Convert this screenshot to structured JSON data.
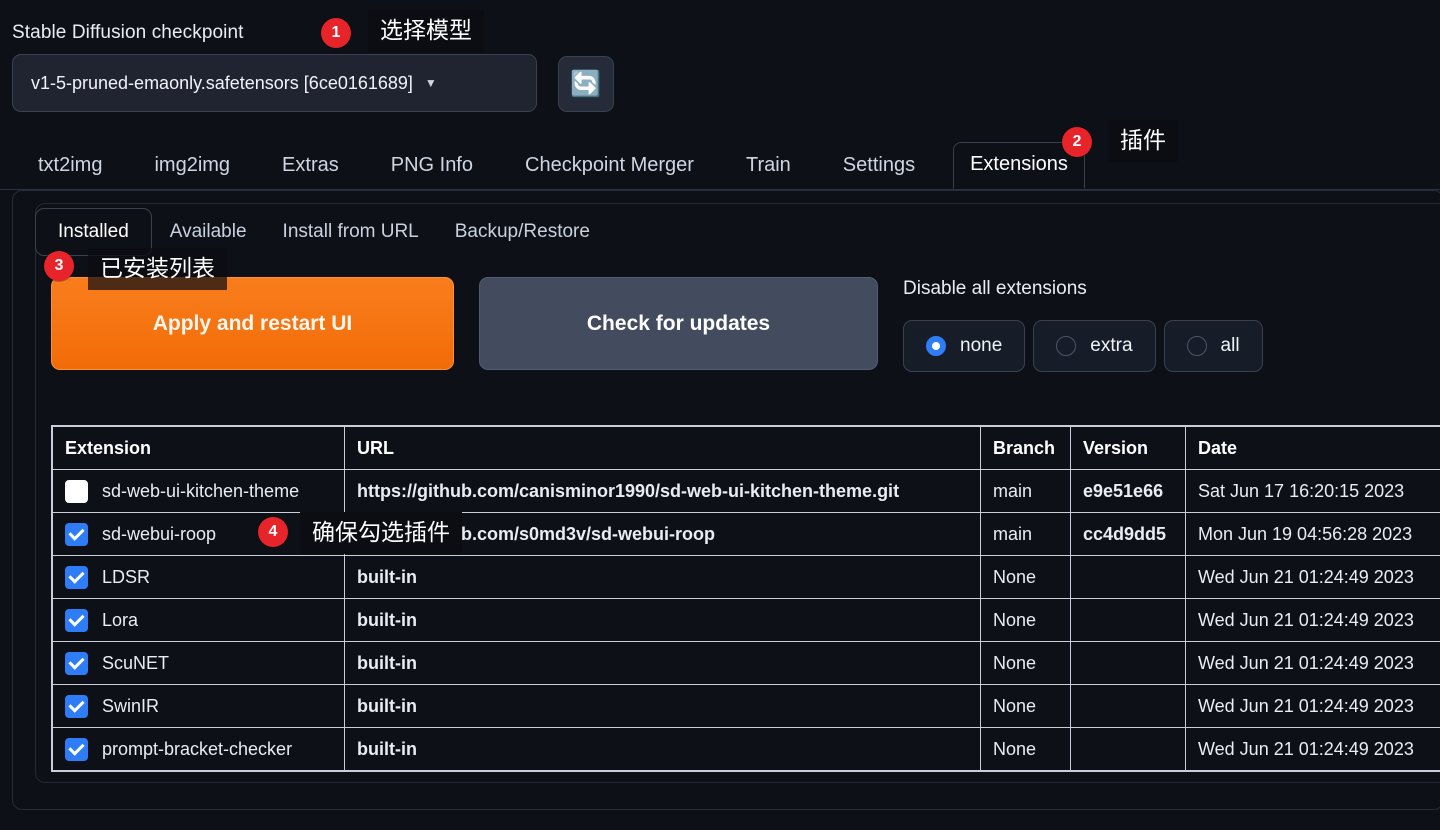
{
  "checkpoint": {
    "label": "Stable Diffusion checkpoint",
    "value": "v1-5-pruned-emaonly.safetensors [6ce0161689]",
    "caret": "▼",
    "refresh_icon": "🔄"
  },
  "top_tabs": [
    {
      "label": "txt2img",
      "active": false
    },
    {
      "label": "img2img",
      "active": false
    },
    {
      "label": "Extras",
      "active": false
    },
    {
      "label": "PNG Info",
      "active": false
    },
    {
      "label": "Checkpoint Merger",
      "active": false
    },
    {
      "label": "Train",
      "active": false
    },
    {
      "label": "Settings",
      "active": false
    },
    {
      "label": "Extensions",
      "active": true
    }
  ],
  "sub_tabs": [
    {
      "label": "Installed",
      "active": true
    },
    {
      "label": "Available",
      "active": false
    },
    {
      "label": "Install from URL",
      "active": false
    },
    {
      "label": "Backup/Restore",
      "active": false
    }
  ],
  "actions": {
    "apply_label": "Apply and restart UI",
    "check_label": "Check for updates"
  },
  "disable_all": {
    "label": "Disable all extensions",
    "options": [
      {
        "label": "none",
        "selected": true
      },
      {
        "label": "extra",
        "selected": false
      },
      {
        "label": "all",
        "selected": false
      }
    ]
  },
  "table": {
    "headers": [
      "Extension",
      "URL",
      "Branch",
      "Version",
      "Date"
    ],
    "rows": [
      {
        "checked": false,
        "extension": "sd-web-ui-kitchen-theme",
        "url": "https://github.com/canisminor1990/sd-web-ui-kitchen-theme.git",
        "branch": "main",
        "version": "e9e51e66",
        "date": "Sat Jun 17 16:20:15 2023"
      },
      {
        "checked": true,
        "extension": "sd-webui-roop",
        "url": "https://github.com/s0md3v/sd-webui-roop",
        "branch": "main",
        "version": "cc4d9dd5",
        "date": "Mon Jun 19 04:56:28 2023"
      },
      {
        "checked": true,
        "extension": "LDSR",
        "url": "built-in",
        "branch": "None",
        "version": "",
        "date": "Wed Jun 21 01:24:49 2023"
      },
      {
        "checked": true,
        "extension": "Lora",
        "url": "built-in",
        "branch": "None",
        "version": "",
        "date": "Wed Jun 21 01:24:49 2023"
      },
      {
        "checked": true,
        "extension": "ScuNET",
        "url": "built-in",
        "branch": "None",
        "version": "",
        "date": "Wed Jun 21 01:24:49 2023"
      },
      {
        "checked": true,
        "extension": "SwinIR",
        "url": "built-in",
        "branch": "None",
        "version": "",
        "date": "Wed Jun 21 01:24:49 2023"
      },
      {
        "checked": true,
        "extension": "prompt-bracket-checker",
        "url": "built-in",
        "branch": "None",
        "version": "",
        "date": "Wed Jun 21 01:24:49 2023"
      }
    ]
  },
  "annotations": [
    {
      "number": "1",
      "text": "选择模型"
    },
    {
      "number": "2",
      "text": "插件"
    },
    {
      "number": "3",
      "text": "已安装列表"
    },
    {
      "number": "4",
      "text": "确保勾选插件"
    }
  ],
  "colors": {
    "background": "#0d1117",
    "accent_orange": "#f26c08",
    "accent_blue": "#2f7df6",
    "badge_red": "#e8242b",
    "button_gray": "#434c5e"
  }
}
